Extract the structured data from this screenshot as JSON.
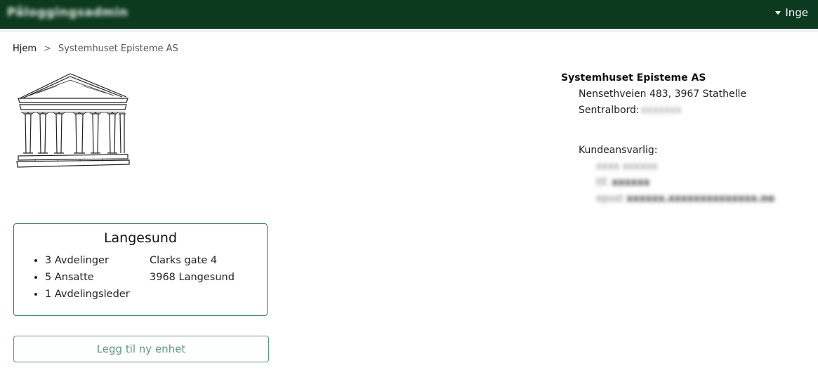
{
  "header": {
    "brand": "Påloggingsadmin",
    "user_name": "Inge"
  },
  "breadcrumb": {
    "home": "Hjem",
    "separator": ">",
    "current": "Systemhuset Episteme AS"
  },
  "company": {
    "name": "Systemhuset Episteme AS",
    "address": "Nensethveien 483, 3967 Stathelle",
    "switchboard_label": "Sentralbord:",
    "switchboard_value": "xxxxxxx",
    "account_manager_label": "Kundeansvarlig:",
    "account_manager_name": "xxxx xxxxxx",
    "account_manager_phone_label": "tlf.",
    "account_manager_phone": "xxxxxx",
    "account_manager_email_label": "epost",
    "account_manager_email": "xxxxxx.xxxxxxxxxxxxxx.no"
  },
  "unit": {
    "title": "Langesund",
    "stats": [
      "3 Avdelinger",
      "5 Ansatte",
      "1 Avdelingsleder"
    ],
    "street": "Clarks gate 4",
    "postal": "3968 Langesund"
  },
  "actions": {
    "add_unit": "Legg til ny enhet"
  },
  "icons": {
    "logo": "classical-building-logo",
    "user_menu": "caret-down-icon"
  },
  "colors": {
    "header_bg": "#0c3a1f",
    "accent": "#2e7d57",
    "button_text": "#5a9b79"
  }
}
